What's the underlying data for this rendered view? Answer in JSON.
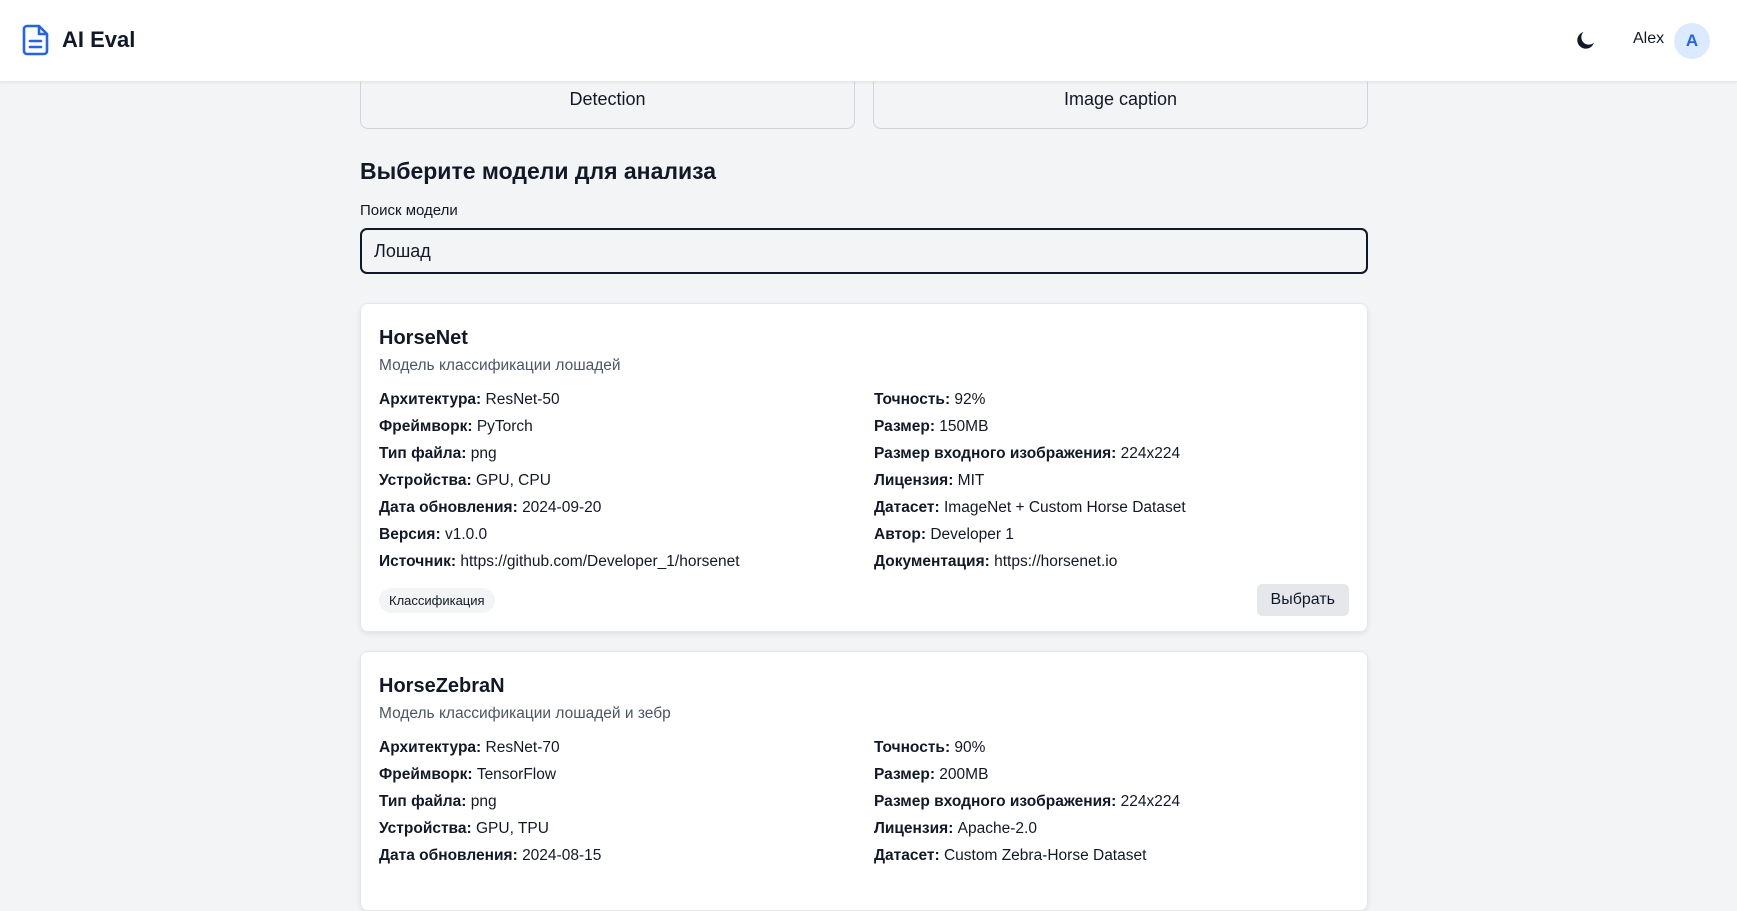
{
  "header": {
    "title": "AI Eval",
    "user_name": "Alex",
    "avatar_initial": "A"
  },
  "tasks": [
    "Detection",
    "Image caption"
  ],
  "model_picker": {
    "heading": "Выберите модели для анализа",
    "search_label": "Поиск модели",
    "search_value": "Лошад"
  },
  "models": [
    {
      "name": "HorseNet",
      "description": "Модель классификации лошадей",
      "left_specs": [
        {
          "label": "Архитектура:",
          "value": "ResNet-50"
        },
        {
          "label": "Фреймворк:",
          "value": "PyTorch"
        },
        {
          "label": "Тип файла:",
          "value": "png"
        },
        {
          "label": "Устройства:",
          "value": "GPU, CPU"
        },
        {
          "label": "Дата обновления:",
          "value": "2024-09-20"
        },
        {
          "label": "Версия:",
          "value": "v1.0.0"
        },
        {
          "label": "Источник:",
          "value": "https://github.com/Developer_1/horsenet"
        }
      ],
      "right_specs": [
        {
          "label": "Точность:",
          "value": "92%"
        },
        {
          "label": "Размер:",
          "value": "150MB"
        },
        {
          "label": "Размер входного изображения:",
          "value": "224x224"
        },
        {
          "label": "Лицензия:",
          "value": "MIT"
        },
        {
          "label": "Датасет:",
          "value": "ImageNet + Custom Horse Dataset"
        },
        {
          "label": "Автор:",
          "value": "Developer 1"
        },
        {
          "label": "Документация:",
          "value": "https://horsenet.io"
        }
      ],
      "tag": "Классификация",
      "select_label": "Выбрать"
    },
    {
      "name": "HorseZebraN",
      "description": "Модель классификации лошадей и зебр",
      "left_specs": [
        {
          "label": "Архитектура:",
          "value": "ResNet-70"
        },
        {
          "label": "Фреймворк:",
          "value": "TensorFlow"
        },
        {
          "label": "Тип файла:",
          "value": "png"
        },
        {
          "label": "Устройства:",
          "value": "GPU, TPU"
        },
        {
          "label": "Дата обновления:",
          "value": "2024-08-15"
        }
      ],
      "right_specs": [
        {
          "label": "Точность:",
          "value": "90%"
        },
        {
          "label": "Размер:",
          "value": "200MB"
        },
        {
          "label": "Размер входного изображения:",
          "value": "224x224"
        },
        {
          "label": "Лицензия:",
          "value": "Apache-2.0"
        },
        {
          "label": "Датасет:",
          "value": "Custom Zebra-Horse Dataset"
        }
      ]
    }
  ],
  "colors": {
    "accent": "#2563eb",
    "background": "#f3f4f6",
    "card": "#ffffff"
  },
  "icons": {
    "brand": "document-icon",
    "theme": "moon-icon"
  }
}
